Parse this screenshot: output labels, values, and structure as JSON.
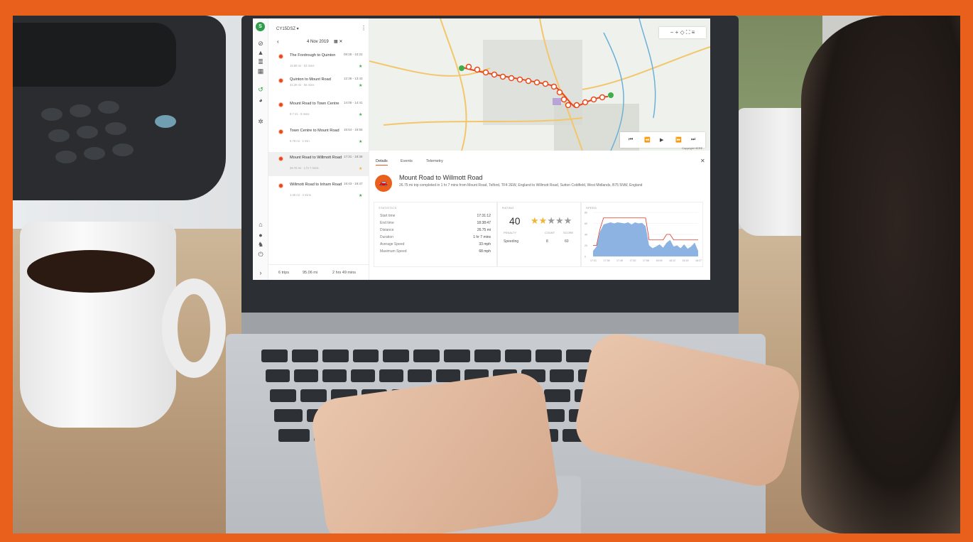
{
  "sidebar": {
    "avatar_letter": "S",
    "icons": [
      "compass-icon",
      "warning-icon",
      "reports-icon",
      "calendar-icon",
      "history-icon",
      "pie-chart-icon",
      "gear-icon",
      "home-icon",
      "user-icon",
      "driver-icon",
      "power-icon",
      "chevron-right-icon"
    ]
  },
  "trips_panel": {
    "vehicle": "CY15DSZ ▾",
    "date": "4 Nov 2019",
    "trips": [
      {
        "name": "The Fordrough to Quinton",
        "time": "09:28 - 10:22",
        "meta": "19.89 mi · 53 mins",
        "rating": "good"
      },
      {
        "name": "Quinton to Mount Road",
        "time": "12:35 - 13:43",
        "meta": "34.29 mi · 66 mins",
        "rating": "good"
      },
      {
        "name": "Mount Road to Town Centre",
        "time": "14:05 - 14:41",
        "meta": "8.7 mi · 8 mins",
        "rating": "good"
      },
      {
        "name": "Town Centre to Mount Road",
        "time": "16:54 - 16:55",
        "meta": "6.78 mi · 1 min",
        "rating": "good"
      },
      {
        "name": "Mount Road to Willmott Road",
        "time": "17:31 - 18:38",
        "meta": "26.75 mi · 1 hr 7 mins",
        "rating": "fair"
      },
      {
        "name": "Willmott Road to Inham Road",
        "time": "18:43 - 18:47",
        "meta": "1.35 mi · 4 mins",
        "rating": "good"
      }
    ],
    "footer": {
      "trip_count": "6 trips",
      "distance": "95.06 mi",
      "duration": "2 hrs 49 mins"
    }
  },
  "map": {
    "controls": "− + ◇ ⛶ ≡",
    "player": [
      "⏮",
      "⏪",
      "▶",
      "⏩",
      "⏭"
    ],
    "copyright": "Copyright HERE"
  },
  "detail": {
    "tabs": [
      "Details",
      "Events",
      "Telemetry"
    ],
    "active_tab": "Details",
    "title": "Mount Road to Willmott Road",
    "description": "26.75 mi trip completed in 1 hr 7 mins from Mount Road, Telford, TF4 2EW, England to Willmott Road, Sutton Coldfield, West Midlands, B75 5NW, England",
    "statistics": {
      "heading": "STATISTICS",
      "rows": [
        {
          "label": "Start time",
          "value": "17:31:12"
        },
        {
          "label": "End time",
          "value": "18:38:47"
        },
        {
          "label": "Distance",
          "value": "26.75 mi"
        },
        {
          "label": "Duration",
          "value": "1 hr 7 mins"
        },
        {
          "label": "Average Speed",
          "value": "33 mph"
        },
        {
          "label": "Maximum Speed",
          "value": "68 mph"
        }
      ]
    },
    "rating": {
      "heading": "RATING",
      "score": "40",
      "stars_on": 2,
      "stars_total": 5,
      "cols": [
        "PENALTY",
        "COUNT",
        "SCORE"
      ],
      "row": {
        "label": "Speeding",
        "count": "8",
        "score": "60"
      }
    }
  },
  "chart_data": {
    "type": "area",
    "title": "SPEED",
    "x": [
      "17:31",
      "17:38",
      "17:45",
      "17:52",
      "17:58",
      "18:05",
      "18:12",
      "18:18",
      "18:27"
    ],
    "yticks": [
      0,
      20,
      40,
      60,
      80
    ],
    "ylim": [
      0,
      80
    ],
    "series": [
      {
        "name": "",
        "values": [
          10,
          18,
          45,
          58,
          60,
          62,
          60,
          62,
          61,
          60,
          62,
          58,
          62,
          60,
          61,
          55,
          20,
          15,
          18,
          22,
          16,
          25,
          30,
          18,
          20,
          15,
          22,
          14,
          18,
          25,
          10
        ]
      },
      {
        "name": "",
        "values": [
          20,
          20,
          50,
          70,
          70,
          70,
          70,
          70,
          70,
          70,
          70,
          70,
          70,
          70,
          70,
          70,
          30,
          30,
          30,
          30,
          30,
          40,
          40,
          30,
          30,
          30,
          30,
          30,
          30,
          30,
          30
        ]
      }
    ],
    "colors": [
      "#8db3e2",
      "#d9342b"
    ]
  }
}
